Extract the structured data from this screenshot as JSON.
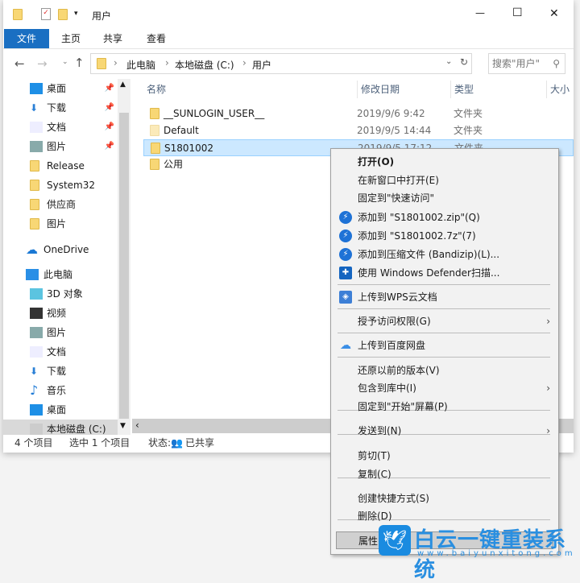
{
  "window": {
    "title": "用户",
    "controls": {
      "minimize": "—",
      "maximize": "☐",
      "close": "✕"
    }
  },
  "ribbon": {
    "tabs": [
      {
        "label": "文件",
        "active": true
      },
      {
        "label": "主页"
      },
      {
        "label": "共享"
      },
      {
        "label": "查看"
      }
    ]
  },
  "address": {
    "breadcrumb": [
      "此电脑",
      "本地磁盘 (C:)",
      "用户"
    ],
    "search_placeholder": "搜索\"用户\""
  },
  "sidebar": {
    "quick": [
      {
        "label": "桌面",
        "icon": "desktop-icon",
        "pinned": true
      },
      {
        "label": "下载",
        "icon": "download-icon",
        "pinned": true
      },
      {
        "label": "文档",
        "icon": "document-icon",
        "pinned": true
      },
      {
        "label": "图片",
        "icon": "pictures-icon",
        "pinned": true
      },
      {
        "label": "Release",
        "icon": "folder-icon"
      },
      {
        "label": "System32",
        "icon": "folder-icon"
      },
      {
        "label": "供应商",
        "icon": "folder-icon"
      },
      {
        "label": "图片",
        "icon": "folder-icon"
      }
    ],
    "onedrive": "OneDrive",
    "thispc": "此电脑",
    "pc_items": [
      {
        "label": "3D 对象",
        "icon": "3d-icon"
      },
      {
        "label": "视频",
        "icon": "video-icon"
      },
      {
        "label": "图片",
        "icon": "pictures-icon"
      },
      {
        "label": "文档",
        "icon": "document-icon"
      },
      {
        "label": "下载",
        "icon": "download-icon"
      },
      {
        "label": "音乐",
        "icon": "music-icon"
      },
      {
        "label": "桌面",
        "icon": "desktop-icon"
      },
      {
        "label": "本地磁盘 (C:)",
        "icon": "drive-icon",
        "selected": true
      }
    ]
  },
  "columns": {
    "name": "名称",
    "date": "修改日期",
    "type": "类型",
    "size": "大小"
  },
  "files": [
    {
      "name": "__SUNLOGIN_USER__",
      "date": "2019/9/6 9:42",
      "type": "文件夹"
    },
    {
      "name": "Default",
      "date": "2019/9/5 14:44",
      "type": "文件夹"
    },
    {
      "name": "S1801002",
      "date": "2019/9/5 17:12",
      "type": "文件夹",
      "selected": true
    },
    {
      "name": "公用",
      "date": "",
      "type": ""
    }
  ],
  "status": {
    "count": "4 个项目",
    "selected": "选中 1 个项目",
    "state_label": "状态:",
    "state": "已共享"
  },
  "context_menu": [
    {
      "label": "打开(O)",
      "bold": true
    },
    {
      "label": "在新窗口中打开(E)"
    },
    {
      "label": "固定到\"快速访问\""
    },
    {
      "label": "添加到 \"S1801002.zip\"(Q)",
      "icon": "bandizip-icon"
    },
    {
      "label": "添加到 \"S1801002.7z\"(7)",
      "icon": "bandizip-icon"
    },
    {
      "label": "添加到压缩文件 (Bandizip)(L)...",
      "icon": "bandizip-icon"
    },
    {
      "label": "使用 Windows Defender扫描...",
      "icon": "defender-icon"
    },
    {
      "label": "上传到WPS云文档",
      "icon": "wps-icon"
    },
    {
      "label": "授予访问权限(G)",
      "submenu": true
    },
    {
      "label": "上传到百度网盘",
      "icon": "baidu-icon"
    },
    {
      "label": "还原以前的版本(V)"
    },
    {
      "label": "包含到库中(I)",
      "submenu": true
    },
    {
      "label": "固定到\"开始\"屏幕(P)"
    },
    {
      "label": "发送到(N)",
      "submenu": true
    },
    {
      "label": "剪切(T)"
    },
    {
      "label": "复制(C)"
    },
    {
      "label": "创建快捷方式(S)"
    },
    {
      "label": "删除(D)"
    },
    {
      "label": "属性(R)"
    }
  ],
  "watermark": {
    "text": "白云一键重装系统",
    "url": "www.baiyunxitong.com"
  },
  "colors": {
    "accent": "#1a6fc2",
    "selection": "#cce8ff",
    "menu_bg": "#f2f2f2"
  }
}
